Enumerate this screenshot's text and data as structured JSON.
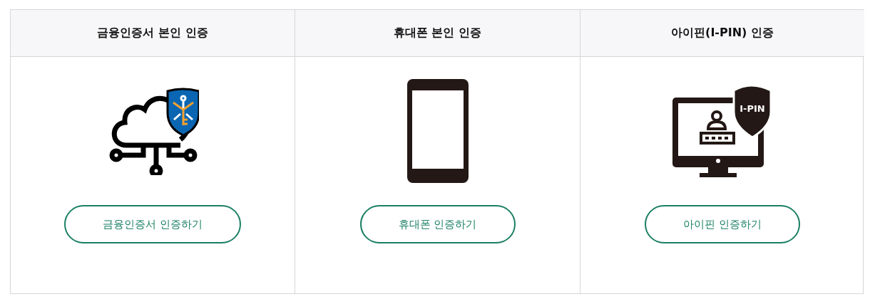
{
  "auth_methods": [
    {
      "kind": "certificate",
      "title": "금융인증서 본인 인증",
      "button": "금융인증서 인증하기"
    },
    {
      "kind": "phone",
      "title": "휴대폰 본인 인증",
      "button": "휴대폰 인증하기"
    },
    {
      "kind": "ipin",
      "title": "아이핀(I-PIN) 인증",
      "badge_text": "I-PIN",
      "button": "아이핀 인증하기"
    }
  ]
}
